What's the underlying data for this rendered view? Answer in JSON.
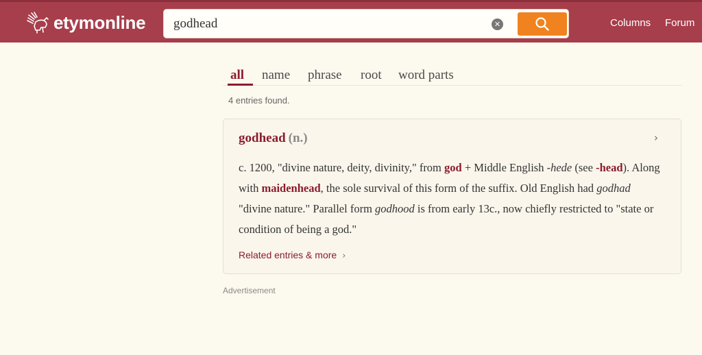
{
  "header": {
    "logo_text": "etymonline",
    "nav": [
      "Columns",
      "Forum"
    ],
    "colors": {
      "bar": "#a73e4b",
      "search_button": "#f0831f"
    }
  },
  "search": {
    "value": "godhead",
    "clear_icon": "close-circle-icon",
    "submit_icon": "search-icon"
  },
  "tabs": [
    {
      "label": "all",
      "active": true
    },
    {
      "label": "name"
    },
    {
      "label": "phrase"
    },
    {
      "label": "root"
    },
    {
      "label": "word parts"
    }
  ],
  "results": {
    "count_text": "4 entries found."
  },
  "entry": {
    "word": "godhead",
    "pos": "(n.)",
    "body": [
      {
        "t": "text",
        "v": "c. 1200, \"divine nature, deity, divinity,\" from "
      },
      {
        "t": "xref",
        "v": "god"
      },
      {
        "t": "text",
        "v": " + Middle English "
      },
      {
        "t": "em",
        "v": "-hede"
      },
      {
        "t": "text",
        "v": " (see "
      },
      {
        "t": "xref",
        "v": "-head"
      },
      {
        "t": "text",
        "v": "). Along with "
      },
      {
        "t": "xref",
        "v": "maidenhead"
      },
      {
        "t": "text",
        "v": ", the sole survival of this form of the suffix. Old English had "
      },
      {
        "t": "em",
        "v": "godhad"
      },
      {
        "t": "text",
        "v": " \"divine nature.\" Parallel form "
      },
      {
        "t": "em",
        "v": "godhood"
      },
      {
        "t": "text",
        "v": " is from early 13c., now chiefly restricted to \"state or condition of being a god.\""
      }
    ],
    "related_label": "Related entries & more"
  },
  "advertisement_label": "Advertisement"
}
